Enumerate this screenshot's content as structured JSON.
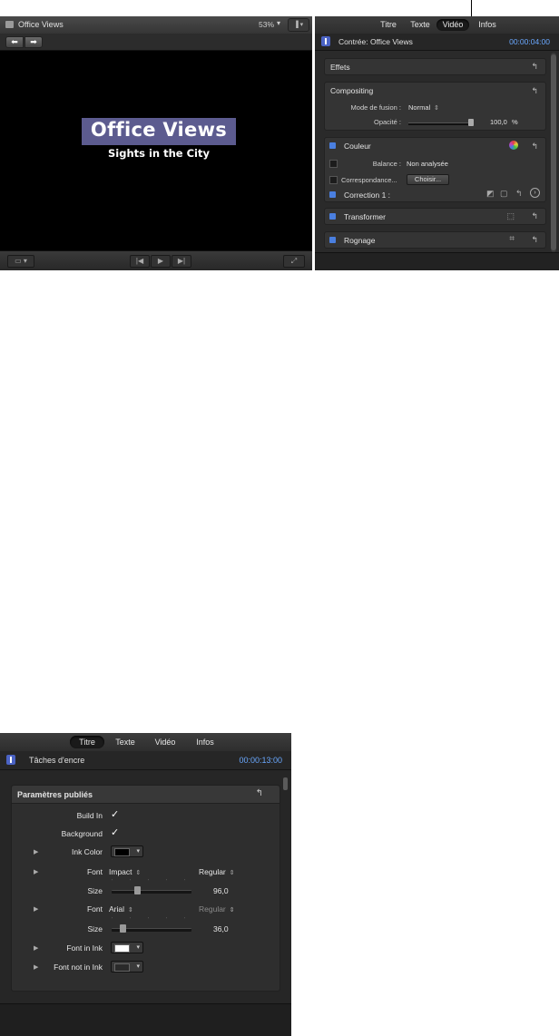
{
  "viewer": {
    "title": "Office Views",
    "zoom": "53%",
    "title_text": "Office Views",
    "subtitle_text": "Sights in the City"
  },
  "inspector_top": {
    "tabs": [
      "Titre",
      "Texte",
      "Vidéo",
      "Infos"
    ],
    "active_tab": "Vidéo",
    "clip_name": "Contrée: Office Views",
    "timecode": "00:00:04:00",
    "sections": {
      "effets": "Effets",
      "compositing": "Compositing",
      "blend_mode_label": "Mode de fusion :",
      "blend_mode_value": "Normal",
      "opacity_label": "Opacité :",
      "opacity_value": "100,0",
      "opacity_unit": "%",
      "couleur": "Couleur",
      "balance_label": "Balance :",
      "balance_value": "Non analysée",
      "match_label": "Correspondance...",
      "choose_button": "Choisir...",
      "correction": "Correction 1 :",
      "transformer": "Transformer",
      "rognage": "Rognage"
    }
  },
  "inspector_bottom": {
    "tabs": [
      "Titre",
      "Texte",
      "Vidéo",
      "Infos"
    ],
    "active_tab": "Titre",
    "clip_name": "Tâches d'encre",
    "timecode": "00:00:13:00",
    "section_title": "Paramètres publiés",
    "params": {
      "build_in": "Build In",
      "background": "Background",
      "ink_color": "Ink Color",
      "font1_label": "Font",
      "font1_value": "Impact",
      "font1_style": "Regular",
      "size1_label": "Size",
      "size1_value": "96,0",
      "font2_label": "Font",
      "font2_value": "Arial",
      "font2_style": "Regular",
      "size2_label": "Size",
      "size2_value": "36,0",
      "font_in_ink": "Font in Ink",
      "font_not_in_ink": "Font not in Ink"
    },
    "colors": {
      "ink_color": "#000000",
      "font_in_ink": "#ffffff",
      "font_not_in_ink": "#2a2a2a"
    }
  },
  "colors": {
    "accent_blue": "#4a7fe0",
    "timecode": "#6aa8ff",
    "title_bg": "#5c5b8f"
  }
}
